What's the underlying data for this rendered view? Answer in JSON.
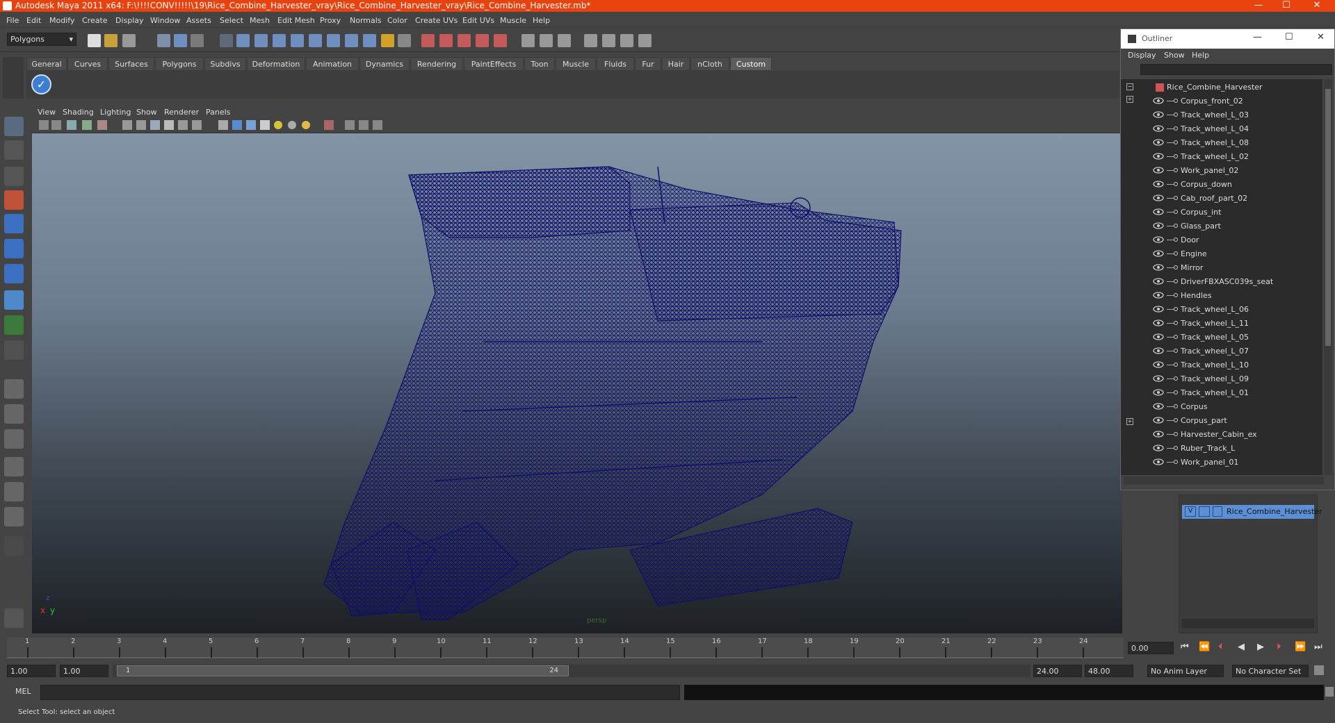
{
  "window": {
    "title": "Autodesk Maya 2011 x64: F:\\!!!!CONV!!!!!\\19\\Rice_Combine_Harvester_vray\\Rice_Combine_Harvester_vray\\Rice_Combine_Harvester.mb*"
  },
  "menu": [
    "File",
    "Edit",
    "Modify",
    "Create",
    "Display",
    "Window",
    "Assets",
    "Select",
    "Mesh",
    "Edit Mesh",
    "Proxy",
    "Normals",
    "Color",
    "Create UVs",
    "Edit UVs",
    "Muscle",
    "Help"
  ],
  "mode_selector": "Polygons",
  "shelf_tabs": [
    "General",
    "Curves",
    "Surfaces",
    "Polygons",
    "Subdivs",
    "Deformation",
    "Animation",
    "Dynamics",
    "Rendering",
    "PaintEffects",
    "Toon",
    "Muscle",
    "Fluids",
    "Fur",
    "Hair",
    "nCloth",
    "Custom"
  ],
  "active_shelf": "Custom",
  "viewport_menu": [
    "View",
    "Shading",
    "Lighting",
    "Show",
    "Renderer",
    "Panels"
  ],
  "viewport": {
    "camera": "persp",
    "axis_x": "x",
    "axis_y": "y",
    "axis_z": "z",
    "wire_color": "#10106a"
  },
  "outliner": {
    "title": "Outliner",
    "menu": [
      "Display",
      "Show",
      "Help"
    ],
    "root": "Rice_Combine_Harvester",
    "items": [
      "Corpus_front_02",
      "Track_wheel_L_03",
      "Track_wheel_L_04",
      "Track_wheel_L_08",
      "Track_wheel_L_02",
      "Work_panel_02",
      "Corpus_down",
      "Cab_roof_part_02",
      "Corpus_int",
      "Glass_part",
      "Door",
      "Engine",
      "Mirror",
      "DriverFBXASC039s_seat",
      "Hendles",
      "Track_wheel_L_06",
      "Track_wheel_L_11",
      "Track_wheel_L_05",
      "Track_wheel_L_07",
      "Track_wheel_L_10",
      "Track_wheel_L_09",
      "Track_wheel_L_01",
      "Corpus",
      "Corpus_part",
      "Harvester_Cabin_ex",
      "Ruber_Track_L",
      "Work_panel_01"
    ]
  },
  "layer": {
    "visible": "V",
    "name": "Rice_Combine_Harvester"
  },
  "timeline": {
    "ticks": [
      "1",
      "2",
      "3",
      "4",
      "5",
      "6",
      "7",
      "8",
      "9",
      "10",
      "11",
      "12",
      "13",
      "14",
      "15",
      "16",
      "17",
      "18",
      "19",
      "20",
      "21",
      "22",
      "23",
      "24"
    ],
    "current_time": "0.00"
  },
  "range": {
    "start": "1.00",
    "start2": "1.00",
    "slider_start": "1",
    "slider_end": "24",
    "end": "24.00",
    "end2": "48.00",
    "anim_layer": "No Anim Layer",
    "char_set": "No Character Set"
  },
  "cmd": {
    "label": "MEL"
  },
  "help": "Select Tool: select an object",
  "colors": {
    "titlebar": "#e8420e",
    "accent": "#5b8fd6"
  }
}
